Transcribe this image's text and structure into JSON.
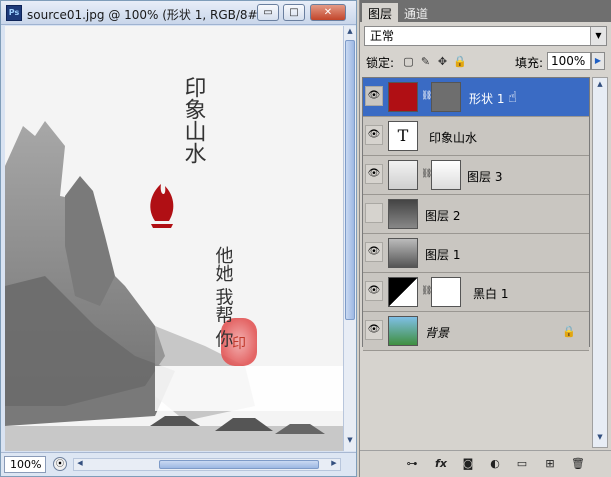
{
  "document": {
    "app_icon": "Ps",
    "title": "source01.jpg @ 100% (形状 1, RGB/8#...",
    "buttons": {
      "minimize": "▭",
      "maximize": "□",
      "close": "✕"
    },
    "zoom": "100%",
    "canvas_text": {
      "calligraphy_title": "印象山水",
      "calligraphy_right": "他她 我帮 你",
      "seal": "印"
    }
  },
  "panel": {
    "tabs": [
      {
        "label": "图层"
      },
      {
        "label": "通道"
      }
    ],
    "blend_mode": "正常",
    "lock_label": "锁定:",
    "fill_label": "填充:",
    "fill_value": "100%",
    "layers": [
      {
        "name": "形状 1",
        "kind": "shape",
        "visible": true,
        "selected": true
      },
      {
        "name": "印象山水",
        "kind": "text",
        "visible": true,
        "selected": false,
        "thumb_glyph": "T"
      },
      {
        "name": "图层 3",
        "kind": "masked",
        "visible": true,
        "selected": false
      },
      {
        "name": "图层 2",
        "kind": "image",
        "visible": false,
        "selected": false
      },
      {
        "name": "图层 1",
        "kind": "image",
        "visible": true,
        "selected": false
      },
      {
        "name": "黑白 1",
        "kind": "adjustment",
        "visible": true,
        "selected": false
      },
      {
        "name": "背景",
        "kind": "background",
        "visible": true,
        "selected": false,
        "locked": true
      }
    ],
    "bottom_icons": [
      "link-icon",
      "fx-icon",
      "mask-icon",
      "adjustment-icon",
      "group-icon",
      "new-layer-icon",
      "trash-icon"
    ],
    "bottom_labels": [
      "⊶",
      "fx",
      "◙",
      "◐",
      "▭",
      "⊞",
      "🗑"
    ]
  },
  "colors": {
    "selected": "#3a6bc4",
    "shape_red": "#b00f14"
  }
}
